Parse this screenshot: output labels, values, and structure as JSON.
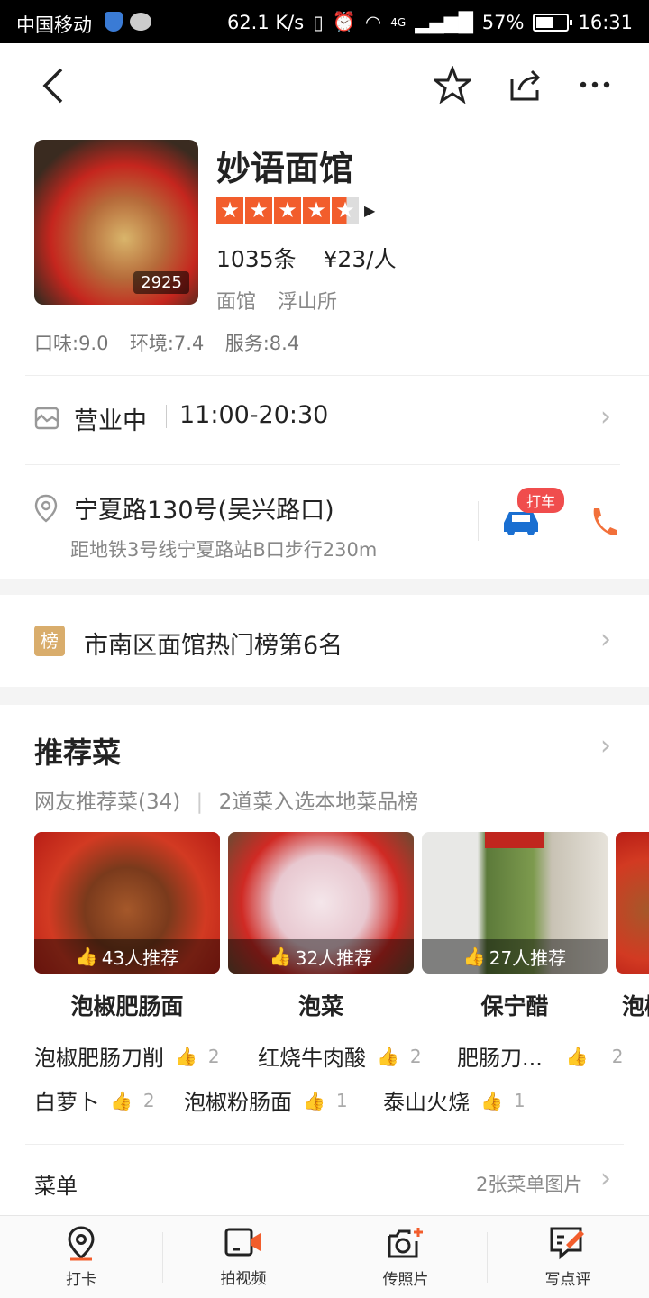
{
  "status_bar": {
    "carrier": "中国移动",
    "speed": "62.1 K/s",
    "network": "4G",
    "battery": "57%",
    "battery_level": 0.57,
    "time": "16:31"
  },
  "shop": {
    "name": "妙语面馆",
    "photo_count": "2925",
    "rating_stars": 4.5,
    "reviews": "1035条",
    "price": "¥23/人",
    "category": "面馆",
    "area": "浮山所",
    "scores": {
      "taste": "口味:9.0",
      "environment": "环境:7.4",
      "service": "服务:8.4"
    }
  },
  "hours": {
    "status": "营业中",
    "time": "11:00-20:30"
  },
  "address": {
    "street": "宁夏路130号(吴兴路口)",
    "transit": "距地铁3号线宁夏路站B口步行230m",
    "taxi_badge": "打车"
  },
  "ranking": {
    "icon_text": "榜",
    "text": "市南区面馆热门榜第6名"
  },
  "recommend": {
    "title": "推荐菜",
    "subtitle_count": "网友推荐菜(34)",
    "subtitle_extra": "2道菜入选本地菜品榜",
    "dishes": [
      {
        "name": "泡椒肥肠面",
        "recommend": "43人推荐"
      },
      {
        "name": "泡菜",
        "recommend": "32人推荐"
      },
      {
        "name": "保宁醋",
        "recommend": "27人推荐"
      },
      {
        "name": "泡椒"
      }
    ],
    "more_items": [
      {
        "name": "泡椒肥肠刀削",
        "count": "2"
      },
      {
        "name": "红烧牛肉酸",
        "count": "2"
      },
      {
        "name": "肥肠刀...",
        "count": "2"
      },
      {
        "name": "白萝卜",
        "count": "2"
      },
      {
        "name": "泡椒粉肠面",
        "count": "1"
      },
      {
        "name": "泰山火烧",
        "count": "1"
      }
    ]
  },
  "menu": {
    "label": "菜单",
    "detail": "2张菜单图片"
  },
  "tabbar": [
    {
      "label": "打卡",
      "icon": "location-pin-icon"
    },
    {
      "label": "拍视频",
      "icon": "video-icon"
    },
    {
      "label": "传照片",
      "icon": "camera-add-icon"
    },
    {
      "label": "写点评",
      "icon": "write-review-icon"
    }
  ],
  "colors": {
    "accent": "#f25d2c",
    "taxi_blue": "#1a6fd1",
    "rank_gold": "#d9ad6c"
  }
}
